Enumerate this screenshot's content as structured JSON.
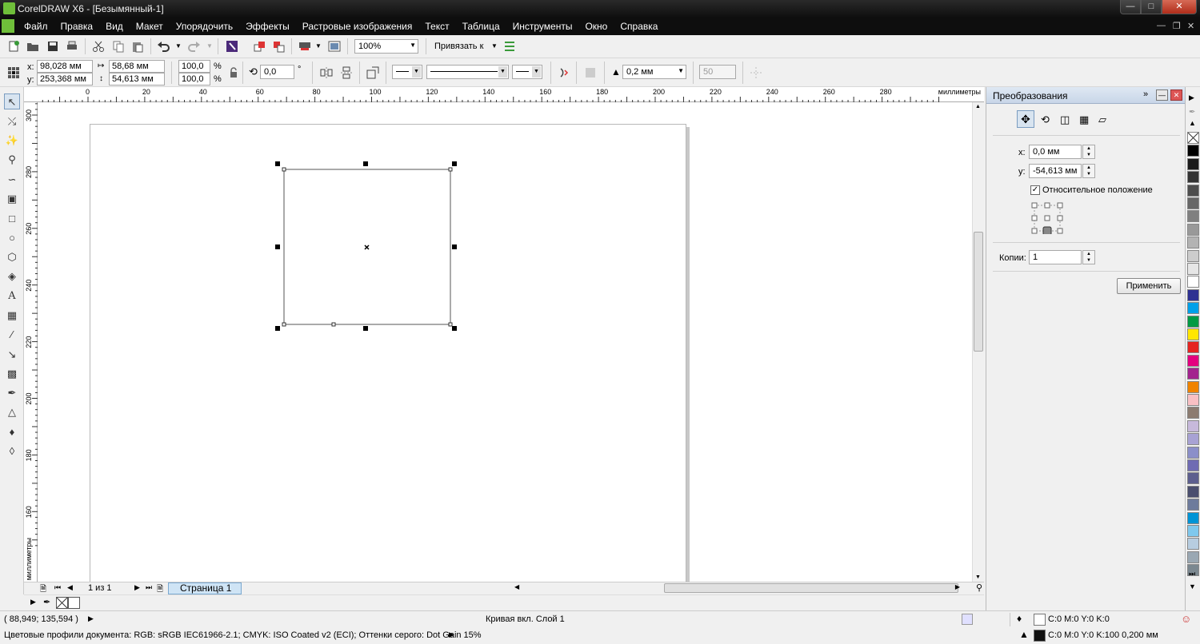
{
  "window": {
    "title": "CorelDRAW X6 - [Безымянный-1]"
  },
  "menu": [
    "Файл",
    "Правка",
    "Вид",
    "Макет",
    "Упорядочить",
    "Эффекты",
    "Растровые изображения",
    "Текст",
    "Таблица",
    "Инструменты",
    "Окно",
    "Справка"
  ],
  "toolbar": {
    "zoom": "100%",
    "snap_label": "Привязать к"
  },
  "property_bar": {
    "x_label": "x:",
    "x": "98,028 мм",
    "y_label": "y:",
    "y": "253,368 мм",
    "width": "58,68 мм",
    "height": "54,613 мм",
    "scale_x": "100,0",
    "scale_y": "100,0",
    "pct": "%",
    "rotation": "0,0",
    "degree": "°",
    "outline_width": "0,2 мм",
    "nodes": "50"
  },
  "rulers": {
    "units": "миллиметры",
    "h_ticks": [
      "0",
      "20",
      "40",
      "60",
      "80",
      "100",
      "120",
      "140",
      "160",
      "180",
      "200",
      "220",
      "240",
      "260",
      "280"
    ],
    "v_ticks": [
      "300",
      "280",
      "260",
      "240",
      "220",
      "200",
      "180",
      "160"
    ]
  },
  "page_nav": {
    "counter": "1 из 1",
    "tab": "Страница 1"
  },
  "docker": {
    "title": "Преобразования",
    "x_label": "x:",
    "x_value": "0,0 мм",
    "y_label": "y:",
    "y_value": "-54,613 мм",
    "relative_label": "Относительное положение",
    "relative_checked": true,
    "copies_label": "Копии:",
    "copies_value": "1",
    "apply": "Применить"
  },
  "palette_colors": [
    "#ffffff",
    "#000000",
    "#1a1a1a",
    "#333333",
    "#4d4d4d",
    "#666666",
    "#808080",
    "#999999",
    "#b3b3b3",
    "#cccccc",
    "#e6e6e6",
    "#ffffff",
    "#2e3192",
    "#00a0e9",
    "#009a44",
    "#ffe600",
    "#e52421",
    "#e4007f",
    "#a3238e",
    "#f08300",
    "#f9c0c4",
    "#8c7b70",
    "#c7b9db",
    "#a8a2d4",
    "#8b8fc9",
    "#6f6bb3",
    "#5c5e8e",
    "#4a4e6e",
    "#6d7b9c",
    "#0094d6",
    "#7fc8ed",
    "#b7cde0",
    "#9aa8b3",
    "#7b8890"
  ],
  "status": {
    "coords": "( 88,949; 135,594 )",
    "object_info": "Кривая вкл. Слой 1",
    "fill_info": "C:0 M:0 Y:0 K:0",
    "color_profile": "Цветовые профили документа: RGB: sRGB IEC61966-2.1; CMYK: ISO Coated v2 (ECI); Оттенки серого: Dot Gain 15%",
    "outline_info": "C:0 M:0 Y:0 K:100  0,200 мм"
  }
}
